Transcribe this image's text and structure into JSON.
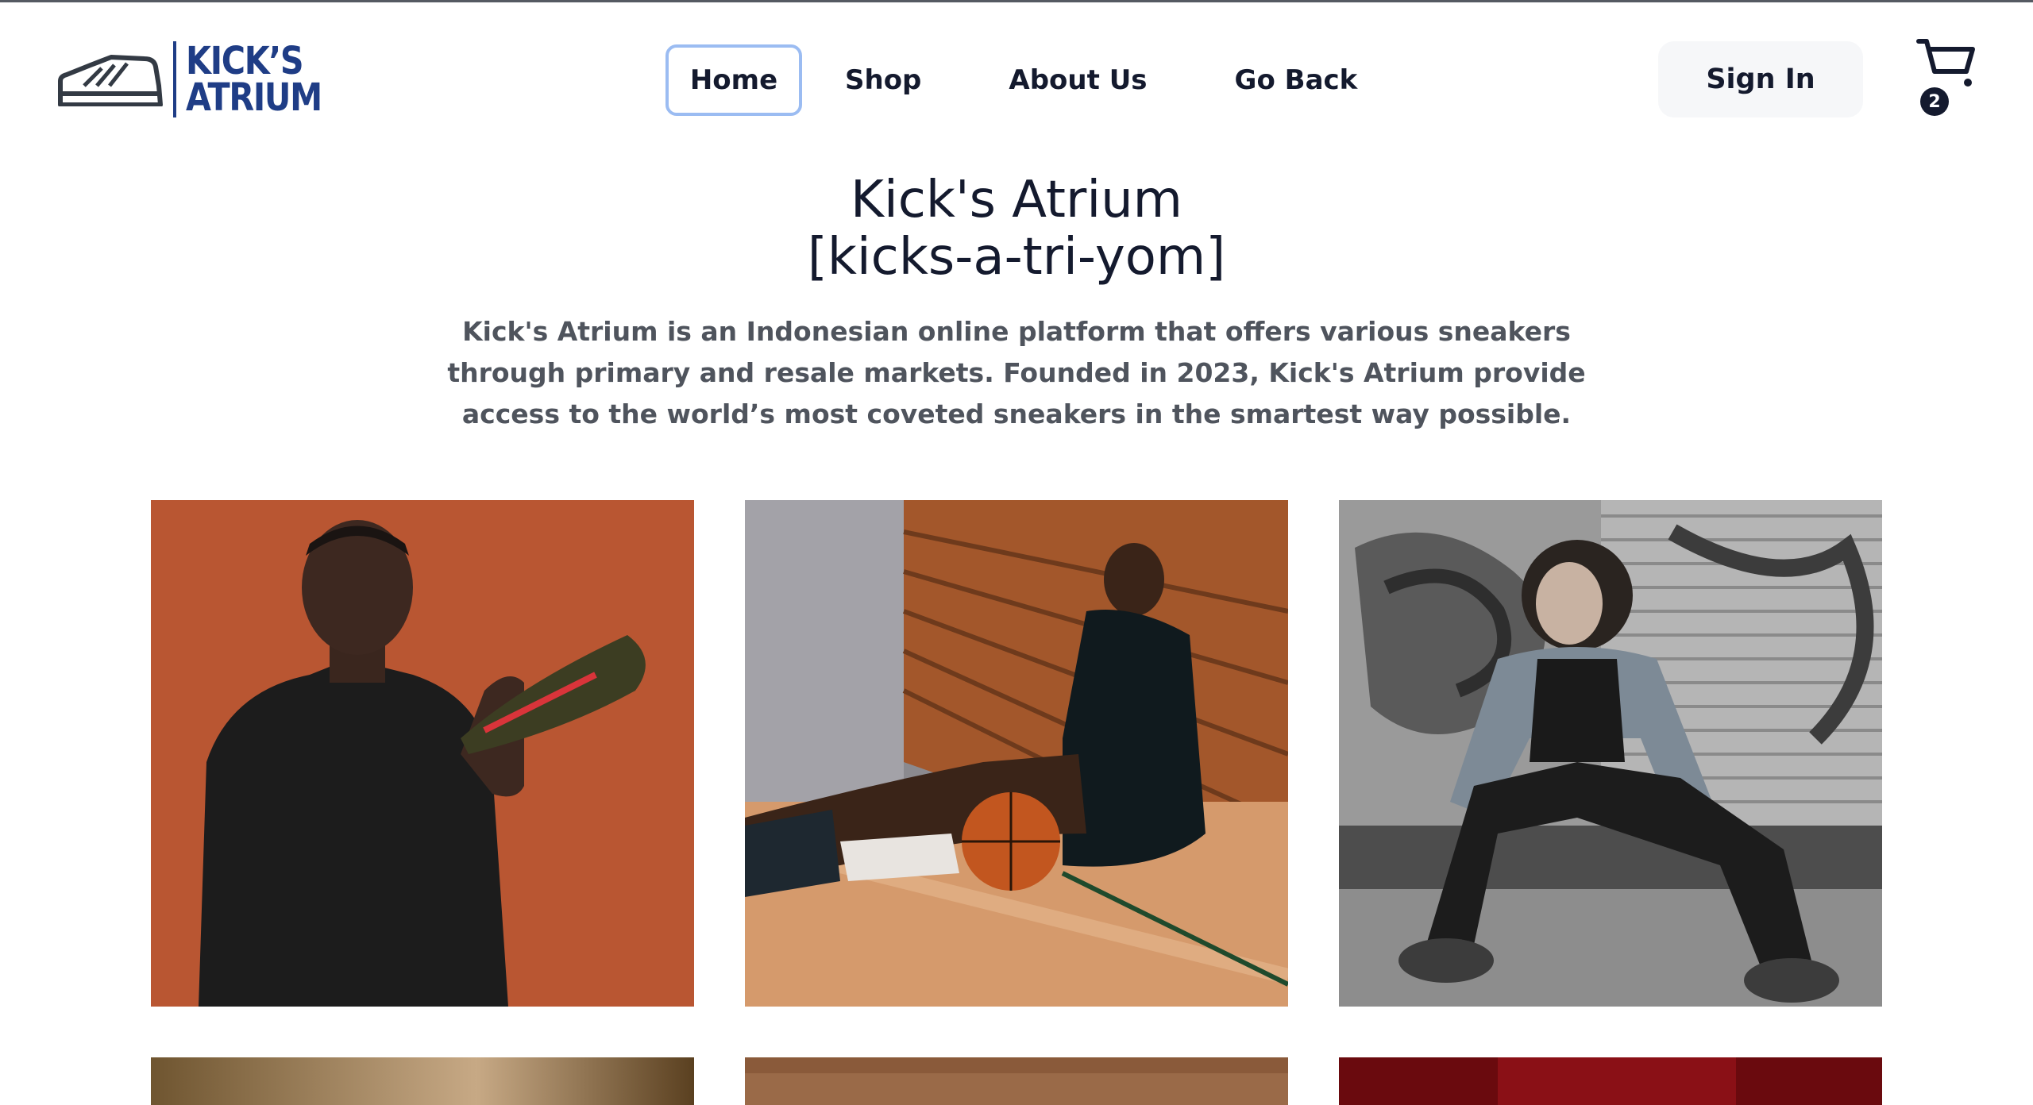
{
  "brand": {
    "logo_line1": "KICK’S",
    "logo_line2": "ATRIUM",
    "color": "#1f3d86"
  },
  "nav": {
    "items": [
      {
        "label": "Home",
        "active": true
      },
      {
        "label": "Shop"
      },
      {
        "label": "About Us"
      },
      {
        "label": "Go Back"
      }
    ],
    "active_outline_color": "#9bbcf2"
  },
  "header": {
    "signin_label": "Sign In",
    "cart_count": "2",
    "cart_icon": "shopping-cart-icon"
  },
  "hero": {
    "title": "Kick's Atrium",
    "pronunciation": "[kicks-a-tri-yom]",
    "description": "Kick's Atrium is an Indonesian online platform that offers various sneakers through primary and resale markets. Founded in 2023, Kick's Atrium provide access to the world’s most coveted sneakers in the smartest way possible."
  },
  "gallery": {
    "photos": [
      {
        "subject": "man-holding-football-boot-photo"
      },
      {
        "subject": "basketball-player-sitting-photo"
      },
      {
        "subject": "man-sitting-graffiti-wall-photo"
      },
      {
        "subject": "gallery-photo-4"
      },
      {
        "subject": "gallery-photo-5"
      },
      {
        "subject": "gallery-photo-6"
      }
    ]
  }
}
